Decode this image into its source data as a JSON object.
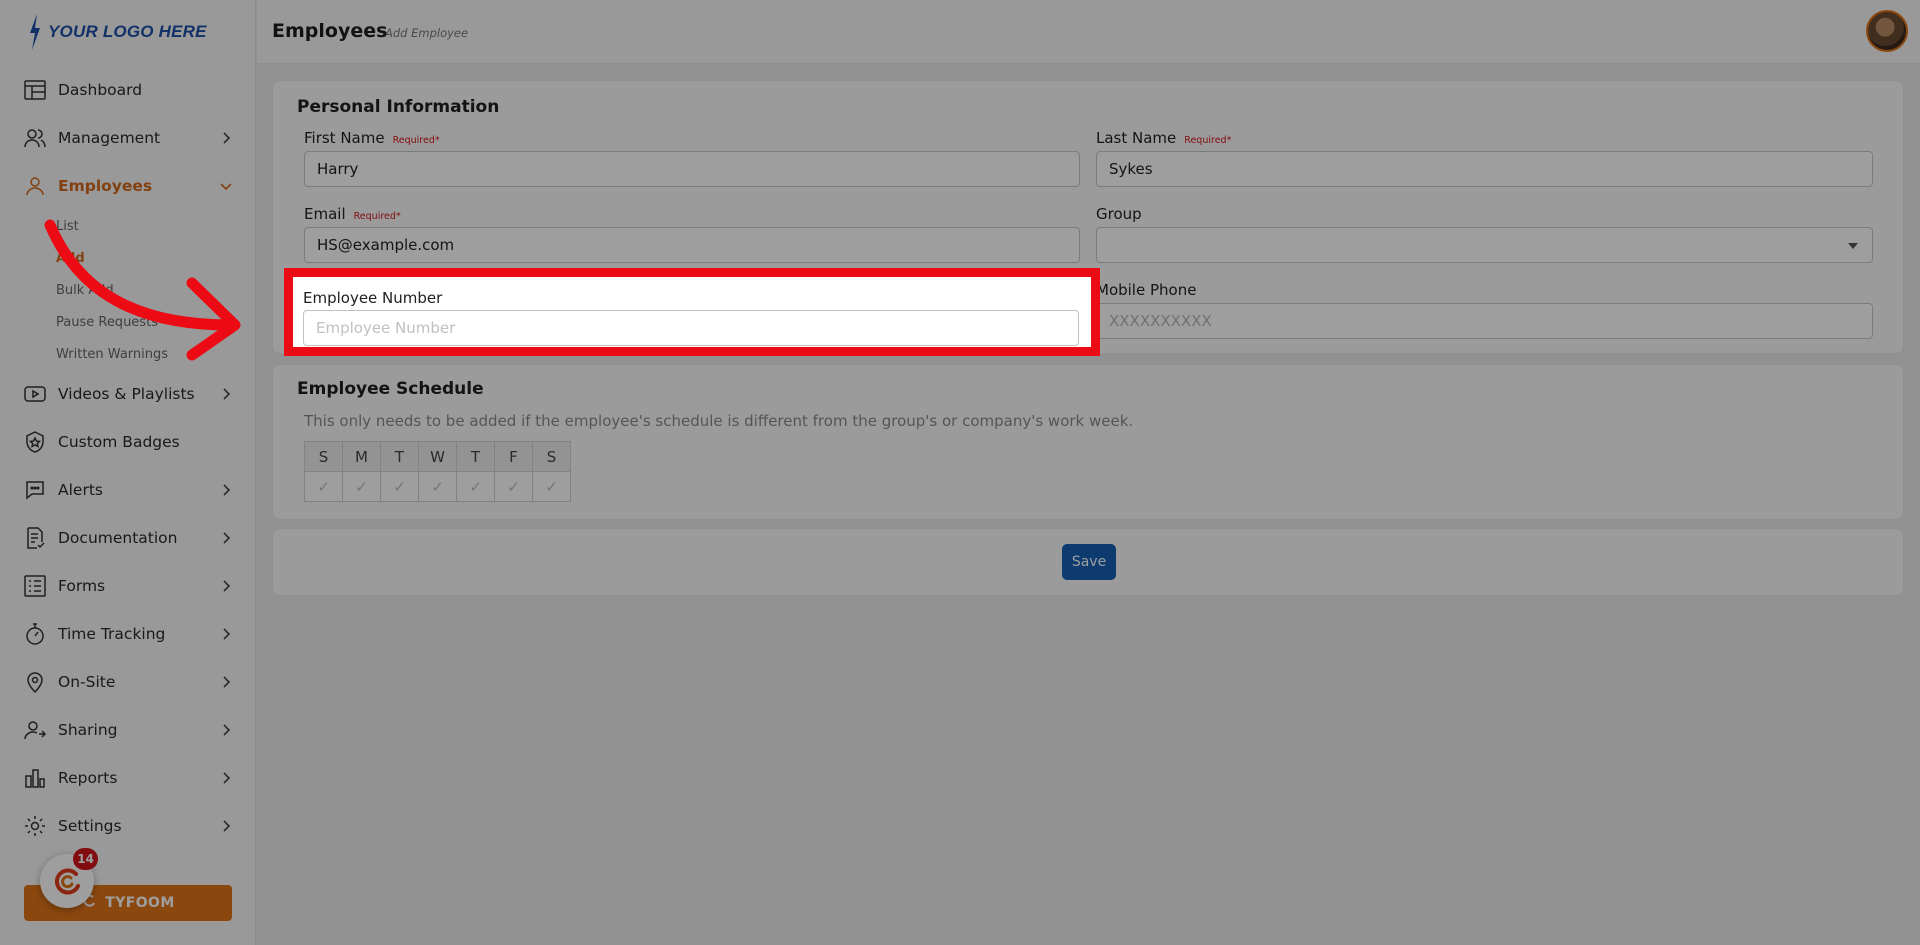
{
  "brand": {
    "logo_text": "YOUR LOGO HERE"
  },
  "header": {
    "title": "Employees",
    "subtitle": "Add Employee"
  },
  "sidebar": {
    "items": [
      {
        "label": "Dashboard"
      },
      {
        "label": "Management"
      },
      {
        "label": "Employees"
      },
      {
        "label": "Videos & Playlists"
      },
      {
        "label": "Custom Badges"
      },
      {
        "label": "Alerts"
      },
      {
        "label": "Documentation"
      },
      {
        "label": "Forms"
      },
      {
        "label": "Time Tracking"
      },
      {
        "label": "On-Site"
      },
      {
        "label": "Sharing"
      },
      {
        "label": "Reports"
      },
      {
        "label": "Settings"
      }
    ],
    "employees_sub": [
      {
        "label": "List"
      },
      {
        "label": "Add"
      },
      {
        "label": "Bulk Add"
      },
      {
        "label": "Pause Requests"
      },
      {
        "label": "Written Warnings"
      }
    ],
    "tyfoom_label": "TYFOOM",
    "notification_count": "14"
  },
  "personal": {
    "title": "Personal Information",
    "required_label": "Required",
    "first_name": {
      "label": "First Name",
      "value": "Harry"
    },
    "last_name": {
      "label": "Last Name",
      "value": "Sykes"
    },
    "email": {
      "label": "Email",
      "value": "HS@example.com"
    },
    "group": {
      "label": "Group",
      "value": ""
    },
    "employee_number": {
      "label": "Employee Number",
      "placeholder": "Employee Number",
      "value": ""
    },
    "mobile_phone": {
      "label": "Mobile Phone",
      "placeholder": "XXXXXXXXXX",
      "value": ""
    }
  },
  "schedule": {
    "title": "Employee Schedule",
    "hint": "This only needs to be added if the employee's schedule is different from the group's or company's work week.",
    "days": [
      "S",
      "M",
      "T",
      "W",
      "T",
      "F",
      "S"
    ],
    "check_glyph": "✓"
  },
  "actions": {
    "save_label": "Save"
  },
  "colors": {
    "accent": "#d46a1d",
    "primary_button": "#1560b5",
    "highlight_border": "#ec0b14",
    "required": "#d0161b"
  }
}
